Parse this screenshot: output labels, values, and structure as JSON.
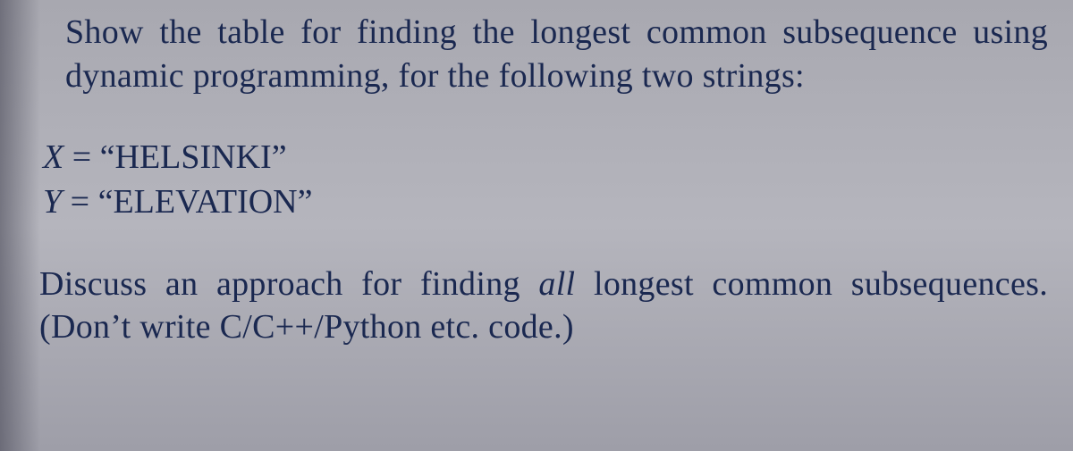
{
  "para1": "Show the table for finding the longest common sub­sequence using dynamic programming, for the fol­lowing two strings:",
  "defs": {
    "x_var": "X",
    "x_eq": " = ",
    "x_val": "“HELSINKI”",
    "y_var": "Y",
    "y_eq": " = ",
    "y_val": "“ELEVATION”"
  },
  "para2": {
    "pre": "Discuss an approach for finding ",
    "emph": "all",
    "post": " longest common subsequences. (Don’t write C/C++/Python etc. code.)"
  }
}
